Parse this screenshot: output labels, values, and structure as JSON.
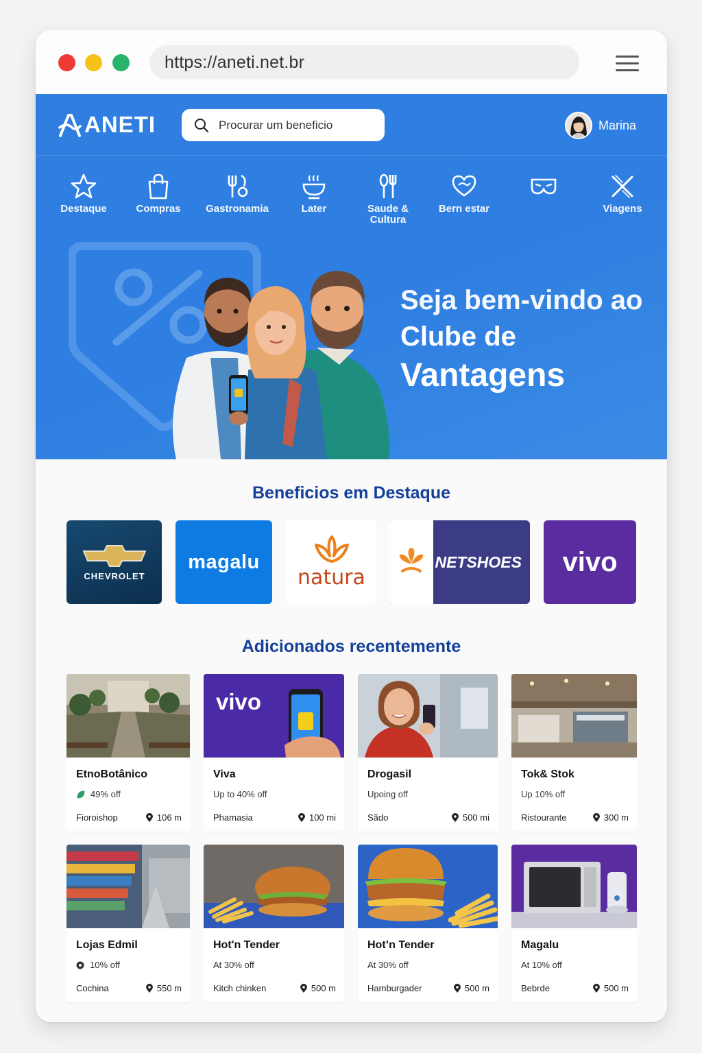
{
  "browser": {
    "url": "https://aneti.net.br"
  },
  "header": {
    "logo": "ANETI",
    "search_placeholder": "Procurar um beneficio",
    "user_name": "Marina"
  },
  "categories": [
    {
      "label": "Destaque",
      "icon": "star-icon"
    },
    {
      "label": "Compras",
      "icon": "shopping-bag-icon"
    },
    {
      "label": "Gastronamia",
      "icon": "cutlery-icon"
    },
    {
      "label": "Later",
      "icon": "bowl-icon"
    },
    {
      "label": "Saude &",
      "label2": "Cultura",
      "icon": "spoon-fork-icon"
    },
    {
      "label": "Bern estar",
      "icon": "heart-icon"
    },
    {
      "label": "",
      "icon": "mask-icon"
    },
    {
      "label": "Viagens",
      "icon": "plane-icon"
    }
  ],
  "hero": {
    "line1": "Seja bem-vindo ao",
    "line2": "Clube de",
    "line3": "Vantagens"
  },
  "featured": {
    "title": "Beneficios em Destaque",
    "brands": [
      {
        "name": "CHEVROLET",
        "bg": "#0f3a5e"
      },
      {
        "name": "magalu",
        "bg": "#0e7be2"
      },
      {
        "name": "natura",
        "bg": "#ffffff"
      },
      {
        "name": "NETSHOES",
        "bg": "#3b3b86"
      },
      {
        "name": "vivo",
        "bg": "#5a2ca0"
      }
    ]
  },
  "recent": {
    "title": "Adicionados recentemente",
    "cards": [
      {
        "name": "EtnoBotânico",
        "discount": "49% off",
        "category": "Fioroishop",
        "distance": "106 m"
      },
      {
        "name": "Viva",
        "discount": "Up to 40% off",
        "category": "Phamasia",
        "distance": "100 mi",
        "img_text": "vivo"
      },
      {
        "name": "Drogasil",
        "discount": "Upoing off",
        "category": "Sãdo",
        "distance": "500 mi"
      },
      {
        "name": "Tok& Stok",
        "discount": "Up 10% off",
        "category": "Ristourante",
        "distance": "300 m"
      },
      {
        "name": "Lojas Edmil",
        "discount": "10% off",
        "category": "Cochina",
        "distance": "550 m"
      },
      {
        "name": "Hot'n Tender",
        "discount": "At 30% off",
        "category": "Kitch chinken",
        "distance": "500 m"
      },
      {
        "name": "Hot’n Tender",
        "discount": "At 30% off",
        "category": "Hamburgader",
        "distance": "500 m"
      },
      {
        "name": "Magalu",
        "discount": "At 10% off",
        "category": "Bebrde",
        "distance": "500 m"
      }
    ]
  },
  "colors": {
    "primary": "#2f7fe2",
    "title": "#15409a"
  }
}
